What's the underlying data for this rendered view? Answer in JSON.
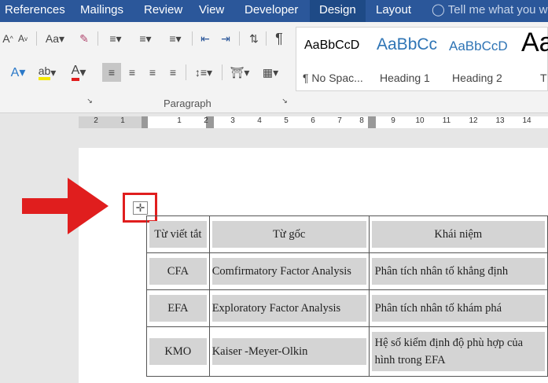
{
  "tabs": {
    "references": "References",
    "mailings": "Mailings",
    "review": "Review",
    "view": "View",
    "developer": "Developer",
    "design": "Design",
    "layout": "Layout",
    "tell_me": "Tell me what you w"
  },
  "ribbon": {
    "paragraph_label": "Paragraph",
    "styles": [
      {
        "sample": "AaBbCcD",
        "name": "¶ No Spac..."
      },
      {
        "sample": "AaBbCc",
        "name": "Heading 1"
      },
      {
        "sample": "AaBbCcD",
        "name": "Heading 2"
      },
      {
        "sample": "Aa",
        "name": "T"
      }
    ]
  },
  "ruler": {
    "numbers": [
      "2",
      "1",
      "1",
      "2",
      "3",
      "4",
      "5",
      "6",
      "7",
      "8",
      "9",
      "10",
      "11",
      "12",
      "13",
      "14"
    ]
  },
  "table": {
    "headers": [
      "Từ viết tắt",
      "Từ gốc",
      "Khái niệm"
    ],
    "rows": [
      [
        "CFA",
        "Comfirmatory Factor Analysis",
        "Phân tích nhân tố khẳng định"
      ],
      [
        "EFA",
        "Exploratory Factor Analysis",
        "Phân tích nhân tố khám phá"
      ],
      [
        "KMO",
        "Kaiser -Meyer-Olkin",
        "Hệ số kiểm định độ phù hợp của",
        "hình trong EFA"
      ]
    ]
  },
  "colors": {
    "title_bar": "#2b579a",
    "annotation_red": "#e01e1e"
  }
}
